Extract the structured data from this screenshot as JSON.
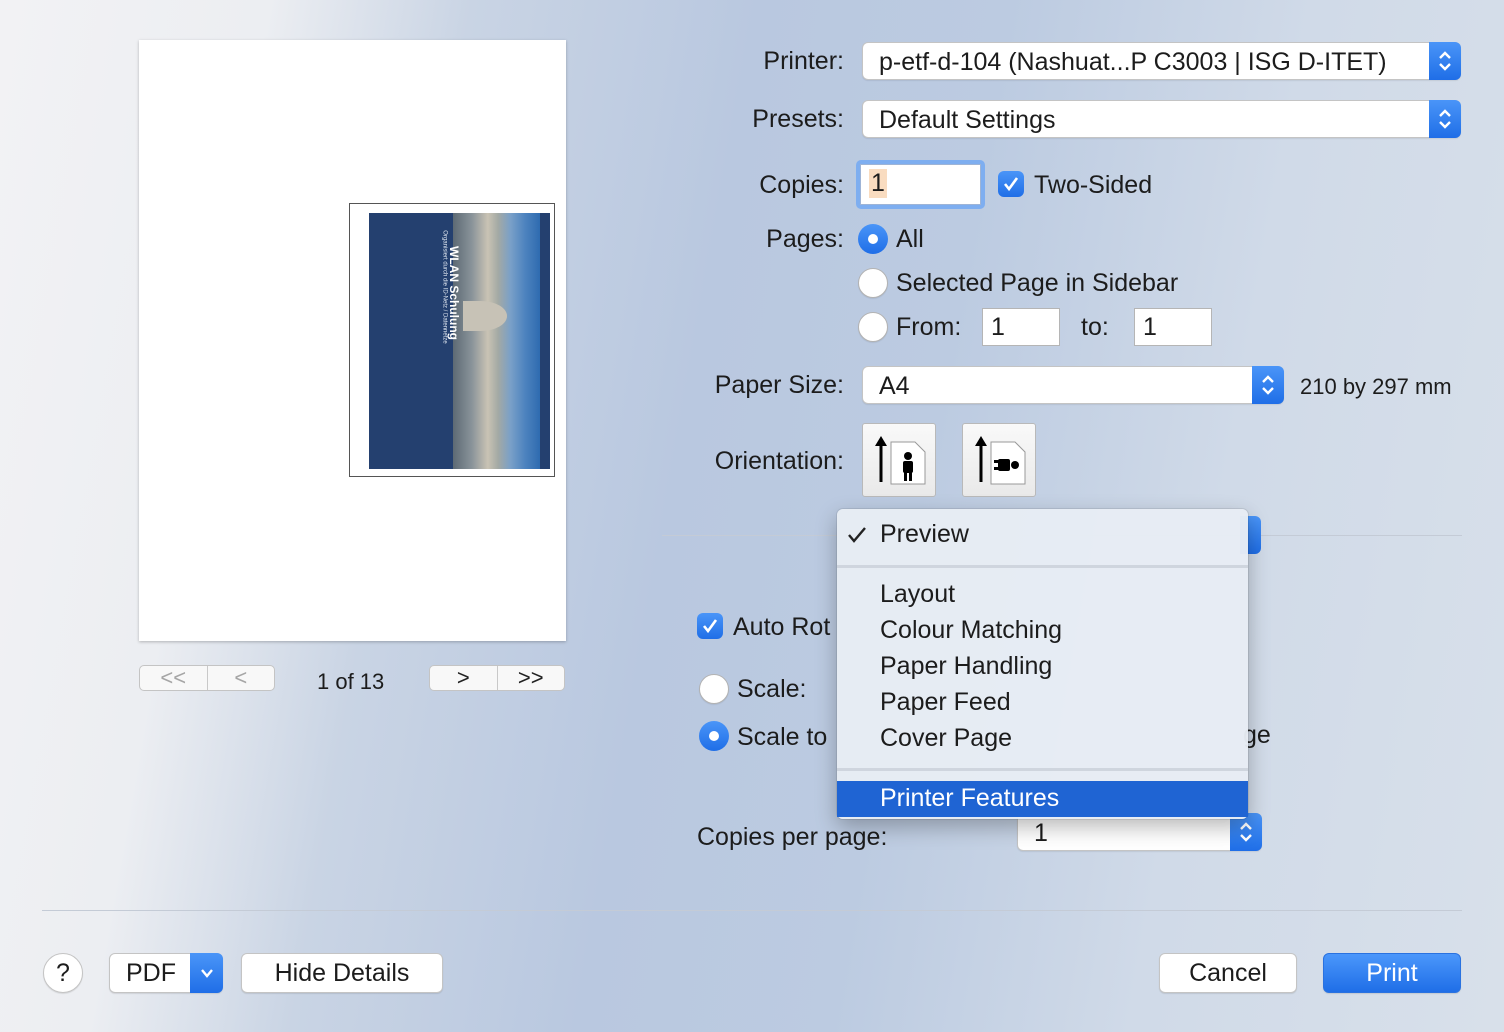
{
  "preview": {
    "thumbnail_title": "WLAN Schulung",
    "thumbnail_subtitle": "Organisiert durch die ID-Netz / Datennetze",
    "page_counter": "1 of 13",
    "nav": {
      "first": "<<",
      "prev": "<",
      "next": ">",
      "last": ">>"
    }
  },
  "printer": {
    "label": "Printer:",
    "value": "p-etf-d-104 (Nashuat...P C3003 | ISG D-ITET)"
  },
  "presets": {
    "label": "Presets:",
    "value": "Default Settings"
  },
  "copies": {
    "label": "Copies:",
    "value": "1",
    "two_sided_label": "Two-Sided",
    "two_sided_checked": true
  },
  "pages": {
    "label": "Pages:",
    "all_label": "All",
    "selected_label": "Selected Page in Sidebar",
    "from_label": "From:",
    "from_value": "1",
    "to_label": "to:",
    "to_value": "1",
    "selected_option": "All"
  },
  "paper_size": {
    "label": "Paper Size:",
    "value": "A4",
    "dimensions": "210 by 297 mm"
  },
  "orientation": {
    "label": "Orientation:",
    "options": [
      "portrait",
      "landscape"
    ],
    "selected": "portrait"
  },
  "section_menu": {
    "items": [
      {
        "label": "Preview",
        "checked": true
      },
      {
        "label": "Layout"
      },
      {
        "label": "Colour Matching"
      },
      {
        "label": "Paper Handling"
      },
      {
        "label": "Paper Feed"
      },
      {
        "label": "Cover Page"
      },
      {
        "label": "Printer Features",
        "highlighted": true
      }
    ]
  },
  "preview_options": {
    "auto_rotate_label": "Auto Rot",
    "scale_label": "Scale:",
    "scale_to_fit_label": "Scale to",
    "scale_to_fit_tail": "ge",
    "copies_per_page_label": "Copies per page:",
    "copies_per_page_value": "1"
  },
  "footer": {
    "help": "?",
    "pdf": "PDF",
    "hide_details": "Hide Details",
    "cancel": "Cancel",
    "print": "Print"
  },
  "colors": {
    "accent": "#1f6ee7",
    "menu_highlight": "#1f64d3",
    "document_blue": "#24406f"
  }
}
